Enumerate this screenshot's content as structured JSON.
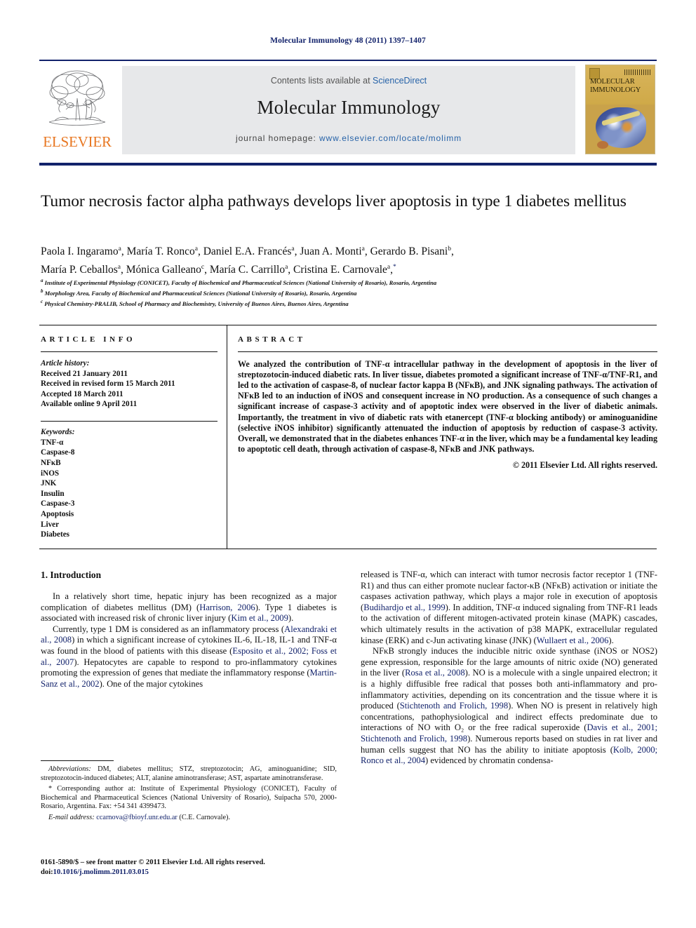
{
  "running_head": "Molecular Immunology 48 (2011) 1397–1407",
  "masthead": {
    "contents_prefix": "Contents lists available at ",
    "sciencedirect": "ScienceDirect",
    "journal_title": "Molecular Immunology",
    "homepage_prefix": "journal homepage:",
    "homepage_url": "www.elsevier.com/locate/molimm",
    "publisher": "ELSEVIER",
    "cover_title_line1": "MOLECULAR",
    "cover_title_line2": "IMMUNOLOGY",
    "colors": {
      "accent_navy": "#12226b",
      "link_blue": "#2763a8",
      "elsevier_orange": "#e87722",
      "band_gray": "#e7e8ea",
      "cover_gold": "#d8b45a"
    }
  },
  "article": {
    "title": "Tumor necrosis factor alpha pathways develops liver apoptosis in type 1 diabetes mellitus",
    "authors_line1": "Paola I. Ingaramoᵃ, María T. Roncoᵃ, Daniel E.A. Francésᵃ, Juan A. Montiᵃ, Gerardo B. Pisaniᵇ,",
    "authors_line2": "María P. Ceballosᵃ, Mónica Galleanoᶜ, María C. Carrilloᵃ, Cristina E. Carnovaleᵃ,*",
    "affiliations": [
      "Institute of Experimental Physiology (CONICET), Faculty of Biochemical and Pharmaceutical Sciences (National University of Rosario), Rosario, Argentina",
      "Morphology Area, Faculty of Biochemical and Pharmaceutical Sciences (National University of Rosario), Rosario, Argentina",
      "Physical Chemistry-PRALIB, School of Pharmacy and Biochemistry, University of Buenos Aires, Buenos Aires, Argentina"
    ],
    "affiliation_marks": [
      "a",
      "b",
      "c"
    ]
  },
  "article_info": {
    "heading": "ARTICLE INFO",
    "history_label": "Article history:",
    "history": [
      "Received 21 January 2011",
      "Received in revised form 15 March 2011",
      "Accepted 18 March 2011",
      "Available online 9 April 2011"
    ],
    "keywords_label": "Keywords:",
    "keywords": [
      "TNF-α",
      "Caspase-8",
      "NFκB",
      "iNOS",
      "JNK",
      "Insulin",
      "Caspase-3",
      "Apoptosis",
      "Liver",
      "Diabetes"
    ]
  },
  "abstract": {
    "heading": "ABSTRACT",
    "text": "We analyzed the contribution of TNF-α intracellular pathway in the development of apoptosis in the liver of streptozotocin-induced diabetic rats. In liver tissue, diabetes promoted a significant increase of TNF-α/TNF-R1, and led to the activation of caspase-8, of nuclear factor kappa B (NFκB), and JNK signaling pathways. The activation of NFκB led to an induction of iNOS and consequent increase in NO production. As a consequence of such changes a significant increase of caspase-3 activity and of apoptotic index were observed in the liver of diabetic animals. Importantly, the treatment in vivo of diabetic rats with etanercept (TNF-α blocking antibody) or aminoguanidine (selective iNOS inhibitor) significantly attenuated the induction of apoptosis by reduction of caspase-3 activity. Overall, we demonstrated that in the diabetes enhances TNF-α in the liver, which may be a fundamental key leading to apoptotic cell death, through activation of caspase-8, NFκB and JNK pathways.",
    "copyright": "© 2011 Elsevier Ltd. All rights reserved."
  },
  "body": {
    "section_heading": "1. Introduction",
    "left_paragraphs": [
      {
        "parts": [
          {
            "t": "In a relatively short time, hepatic injury has been recognized as a major complication of diabetes mellitus (DM) ("
          },
          {
            "t": "Harrison, 2006",
            "cite": true
          },
          {
            "t": "). Type 1 diabetes is associated with increased risk of chronic liver injury ("
          },
          {
            "t": "Kim et al., 2009",
            "cite": true
          },
          {
            "t": ")."
          }
        ]
      },
      {
        "parts": [
          {
            "t": "Currently, type 1 DM is considered as an inflammatory process ("
          },
          {
            "t": "Alexandraki et al., 2008",
            "cite": true
          },
          {
            "t": ") in which a significant increase of cytokines IL-6, IL-18, IL-1 and TNF-α was found in the blood of patients with this disease ("
          },
          {
            "t": "Esposito et al., 2002; Foss et al., 2007",
            "cite": true
          },
          {
            "t": "). Hepatocytes are capable to respond to pro-inflammatory cytokines promoting the expression of genes that mediate the inflammatory response ("
          },
          {
            "t": "Martin-Sanz et al., 2002",
            "cite": true
          },
          {
            "t": "). One of the major cytokines"
          }
        ]
      }
    ],
    "right_paragraphs": [
      {
        "no_indent": true,
        "parts": [
          {
            "t": "released is TNF-α, which can interact with tumor necrosis factor receptor 1 (TNF-R1) and thus can either promote nuclear factor-κB (NFκB) activation or initiate the caspases activation pathway, which plays a major role in execution of apoptosis ("
          },
          {
            "t": "Budihardjo et al., 1999",
            "cite": true
          },
          {
            "t": "). In addition, TNF-α induced signaling from TNF-R1 leads to the activation of different mitogen-activated protein kinase (MAPK) cascades, which ultimately results in the activation of p38 MAPK, extracellular regulated kinase (ERK) and c-Jun activating kinase (JNK) ("
          },
          {
            "t": "Wullaert et al., 2006",
            "cite": true
          },
          {
            "t": ")."
          }
        ]
      },
      {
        "parts": [
          {
            "t": "NFκB strongly induces the inducible nitric oxide synthase (iNOS or NOS2) gene expression, responsible for the large amounts of nitric oxide (NO) generated in the liver ("
          },
          {
            "t": "Rosa et al., 2008",
            "cite": true
          },
          {
            "t": "). NO is a molecule with a single unpaired electron; it is a highly diffusible free radical that posses both anti-inflammatory and pro-inflammatory activities, depending on its concentration and the tissue where it is produced ("
          },
          {
            "t": "Stichtenoth and Frolich, 1998",
            "cite": true
          },
          {
            "t": "). When NO is present in relatively high concentrations, pathophysiological and indirect effects predominate due to interactions of NO with O₂ or the free radical superoxide ("
          },
          {
            "t": "Davis et al., 2001; Stichtenoth and Frolich, 1998",
            "cite": true
          },
          {
            "t": "). Numerous reports based on studies in rat liver and human cells suggest that NO has the ability to initiate apoptosis ("
          },
          {
            "t": "Kolb, 2000; Ronco et al., 2004",
            "cite": true
          },
          {
            "t": ") evidenced by chromatin condensa-"
          }
        ]
      }
    ]
  },
  "footnotes": {
    "abbreviations_label": "Abbreviations:",
    "abbreviations_text": " DM, diabetes mellitus; STZ, streptozotocin; AG, aminoguanidine; SID, streptozotocin-induced diabetes; ALT, alanine aminotransferase; AST, aspartate aminotransferase.",
    "corresponding_marker": "*",
    "corresponding_text": " Corresponding author at: Institute of Experimental Physiology (CONICET), Faculty of Biochemical and Pharmaceutical Sciences (National University of Rosario), Suipacha 570, 2000-Rosario, Argentina. Fax: +54 341 4399473.",
    "email_label": "E-mail address:",
    "email": "ccarnova@fbioyf.unr.edu.ar",
    "email_suffix": " (C.E. Carnovale)."
  },
  "imprint": {
    "line1": "0161-5890/$ – see front matter © 2011 Elsevier Ltd. All rights reserved.",
    "doi_label": "doi:",
    "doi": "10.1016/j.molimm.2011.03.015"
  }
}
